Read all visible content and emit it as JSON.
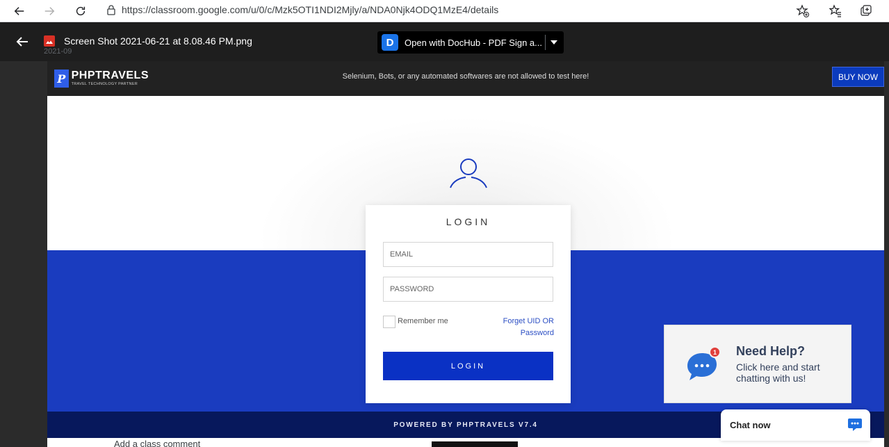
{
  "browser": {
    "url": "https://classroom.google.com/u/0/c/Mzk5OTI1NDI2Mjly/a/NDA0Njk4ODQ1MzE4/details"
  },
  "viewer": {
    "file_name": "Screen Shot 2021-06-21 at 8.08.46 PM.png",
    "file_sub": "2021-09",
    "open_with_label": "Open with DocHub - PDF Sign a...",
    "open_with_logo": "D"
  },
  "php": {
    "logo_name": "PHPTRAVELS",
    "logo_tagline": "TRAVEL TECHNOLOGY PARTNER",
    "logo_mark": "P",
    "warning": "Selenium, Bots, or any automated softwares are not allowed to test here!",
    "buy_now": "BUY NOW",
    "footer": "POWERED BY PHPTRAVELS V7.4"
  },
  "login": {
    "title": "LOGIN",
    "email_placeholder": "EMAIL",
    "password_placeholder": "PASSWORD",
    "remember": "Remember me",
    "forget": "Forget UID OR Password",
    "button": "LOGIN"
  },
  "help": {
    "badge": "1",
    "title": "Need Help?",
    "subtitle": "Click here and start chatting with us!"
  },
  "chat": {
    "label": "Chat now"
  },
  "below": {
    "comment": "Add a class comment"
  },
  "colors": {
    "brand_blue": "#1a3cbf",
    "button_blue": "#0a31c4",
    "footer_navy": "#07185c",
    "top_dark": "#222222"
  }
}
